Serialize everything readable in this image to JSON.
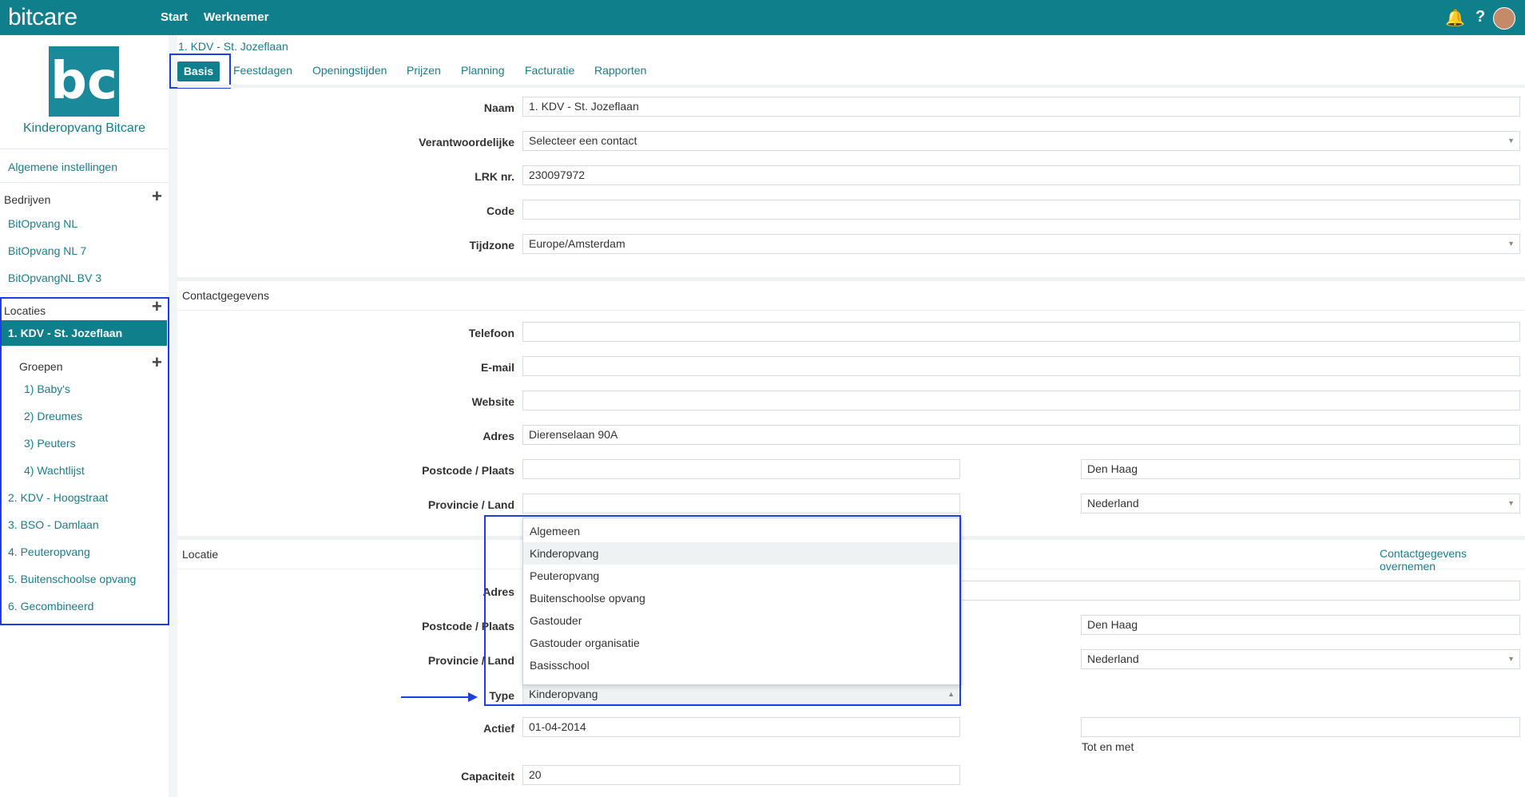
{
  "app": {
    "brand": "bitcare",
    "nav": [
      "Start",
      "Werknemer"
    ]
  },
  "sidebar": {
    "company": "Kinderopvang Bitcare",
    "general_settings": "Algemene instellingen",
    "companies_header": "Bedrijven",
    "companies": [
      "BitOpvang NL",
      "BitOpvang NL 7",
      "BitOpvangNL BV 3"
    ],
    "locations_header": "Locaties",
    "selected_location": "1. KDV - St. Jozeflaan",
    "groups_header": "Groepen",
    "groups": [
      "1) Baby's",
      "2) Dreumes",
      "3) Peuters",
      "4) Wachtlijst"
    ],
    "locations": [
      "2. KDV - Hoogstraat",
      "3. BSO - Damlaan",
      "4. Peuteropvang",
      "5. Buitenschoolse opvang",
      "6. Gecombineerd"
    ]
  },
  "breadcrumb": "1. KDV - St. Jozeflaan",
  "tabs": {
    "active": "Basis",
    "others": [
      "Feestdagen",
      "Openingstijden",
      "Prijzen",
      "Planning",
      "Facturatie",
      "Rapporten"
    ]
  },
  "form": {
    "naam": {
      "label": "Naam",
      "value": "1. KDV - St. Jozeflaan"
    },
    "verantwoordelijke": {
      "label": "Verantwoordelijke",
      "value": "Selecteer een contact"
    },
    "lrk": {
      "label": "LRK nr.",
      "value": "230097972"
    },
    "code": {
      "label": "Code",
      "value": ""
    },
    "tijdzone": {
      "label": "Tijdzone",
      "value": "Europe/Amsterdam"
    }
  },
  "contact": {
    "title": "Contactgegevens",
    "telefoon": {
      "label": "Telefoon",
      "value": ""
    },
    "email": {
      "label": "E-mail",
      "value": ""
    },
    "website": {
      "label": "Website",
      "value": ""
    },
    "adres": {
      "label": "Adres",
      "value": "Dierenselaan 90A"
    },
    "postcode": {
      "label": "Postcode / Plaats",
      "postcode": "",
      "plaats": "Den Haag"
    },
    "provincie": {
      "label": "Provincie / Land",
      "provincie": "",
      "land": "Nederland"
    }
  },
  "locatie": {
    "title": "Locatie",
    "copy_link": "Contactgegevens overnemen",
    "adres": {
      "label": "Adres",
      "value": ""
    },
    "postcode": {
      "label": "Postcode / Plaats",
      "plaats": "Den Haag"
    },
    "provincie": {
      "label": "Provincie / Land",
      "land": "Nederland"
    },
    "type": {
      "label": "Type",
      "value": "Kinderopvang"
    },
    "actief": {
      "label": "Actief",
      "value": "01-04-2014",
      "end_note": "Tot en met"
    },
    "capaciteit": {
      "label": "Capaciteit",
      "value": "20"
    }
  },
  "type_dropdown": {
    "options": [
      "Algemeen",
      "Kinderopvang",
      "Peuteropvang",
      "Buitenschoolse opvang",
      "Gastouder",
      "Gastouder organisatie",
      "Basisschool"
    ],
    "highlighted": "Kinderopvang"
  },
  "colors": {
    "primary": "#0f7f8c",
    "annotation": "#1f3ee0"
  },
  "icons": {
    "notifications": "bell-icon",
    "help": "help-icon",
    "add": "plus-icon",
    "caret": "caret-down-icon"
  }
}
